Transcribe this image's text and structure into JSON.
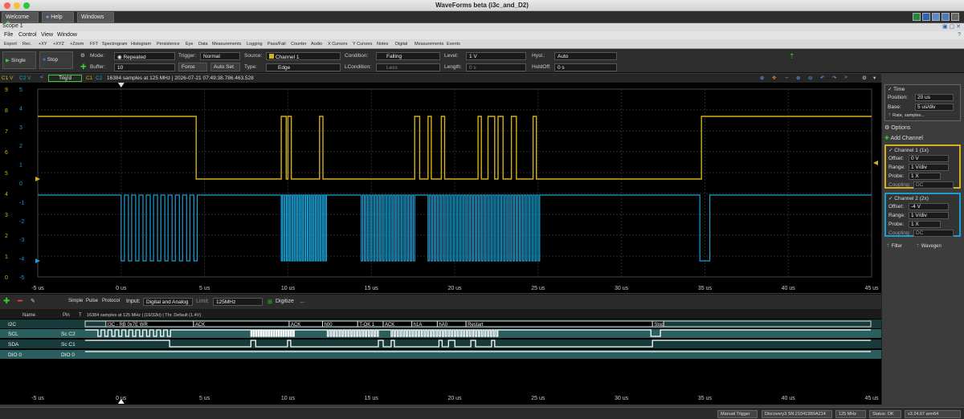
{
  "window": {
    "title": "WaveForms beta (i3c_and_D2)"
  },
  "tabs": [
    {
      "label": "Welcome"
    },
    {
      "label": "Help"
    },
    {
      "label": "Windows"
    }
  ],
  "scope": {
    "title": "Scope 1"
  },
  "menu": [
    "File",
    "Control",
    "View",
    "Window"
  ],
  "toolbar": [
    "Export",
    "Rec.",
    "+XY",
    "+XYZ",
    "+Zoom",
    "FFT",
    "Spectrogram",
    "Histogram",
    "Persistence",
    "Eye",
    "Data",
    "Measurements",
    "Logging",
    "Pass/Fail",
    "Counter",
    "Audio",
    "X Cursors",
    "Y Cursors",
    "Notes",
    "Digital",
    "Measurements",
    "Events"
  ],
  "controls": {
    "single": "Single",
    "stop": "Stop",
    "mode_label": "Mode:",
    "mode_value": "Repeated",
    "buffer_label": "Buffer:",
    "buffer_value": "10",
    "trigger_label": "Trigger:",
    "trigger_value": "Normal",
    "force": "Force",
    "autoset": "Auto Set",
    "source_label": "Source:",
    "source_value": "Channel 1",
    "type_label": "Type:",
    "type_value": "Edge",
    "condition_label": "Condition:",
    "condition_value": "Falling",
    "lcondition_label": "LCondition:",
    "lcondition_value": "Less",
    "level_label": "Level:",
    "level_value": "1 V",
    "length_label": "Length:",
    "length_value": "0 s",
    "hyst_label": "Hyst.:",
    "hyst_value": "Auto",
    "holdoff_label": "HoldOff:",
    "holdoff_value": "0 s"
  },
  "infobar": {
    "c1": "C1 V",
    "c2": "C2 V",
    "trig": "Trig'd",
    "c1b": "C1",
    "c2b": "C2",
    "text": "16384 samples at 125 MHz | 2026-07-21 07:49:38.786.463.528"
  },
  "plot": {
    "y_left1": [
      "9",
      "8",
      "7",
      "6",
      "5",
      "4",
      "3",
      "2",
      "1",
      "0"
    ],
    "y_left2": [
      "5",
      "4",
      "3",
      "2",
      "1",
      "0",
      "-1",
      "-2",
      "-3",
      "-4",
      "-5"
    ],
    "x_ticks": [
      "-5 us",
      "0 us",
      "5 us",
      "10 us",
      "15 us",
      "20 us",
      "25 us",
      "30 us",
      "35 us",
      "40 us",
      "45 us"
    ],
    "colors": {
      "ch1": "#d4b01c",
      "ch2": "#1a9fd4"
    }
  },
  "digital": {
    "simple": "Simple",
    "pulse": "Pulse",
    "protocol": "Protocol",
    "input_label": "Input:",
    "input_value": "Digital and Analog",
    "limit_label": "Limit:",
    "limit_value": "125MHz",
    "digitize": "Digitize",
    "col_name": "Name",
    "col_pin": "Pin",
    "col_t": "T",
    "info": "16384 samples at 125 MHz | (16/32ki) | Thr. Default (1.4V)",
    "rows": [
      {
        "name": "I2C",
        "pin": ""
      },
      {
        "name": "SCL",
        "pin": "Sc C2"
      },
      {
        "name": "SDA",
        "pin": "Sc C1"
      },
      {
        "name": "DIO 0",
        "pin": "DIO 0"
      }
    ],
    "decode": [
      "I3C - RB 0x7E WR",
      "ACK",
      "ACK",
      "h00",
      "T-OK 1",
      "ACK",
      "h1A",
      "hA0",
      "Restart",
      "Stop"
    ],
    "x_ticks": [
      "-5 us",
      "0 us",
      "5 us",
      "10 us",
      "15 us",
      "20 us",
      "25 us",
      "30 us",
      "35 us",
      "40 us",
      "45 us"
    ]
  },
  "panel": {
    "time_title": "Time",
    "position_label": "Position:",
    "position_value": "20 us",
    "base_label": "Base:",
    "base_value": "5 us/div",
    "rate": "Rate, samples...",
    "options": "Options",
    "add_channel": "Add Channel",
    "ch1_title": "Channel 1 (1x)",
    "ch1_offset_label": "Offset:",
    "ch1_offset": "0 V",
    "ch1_range_label": "Range:",
    "ch1_range": "1 V/div",
    "ch1_probe_label": "Probe:",
    "ch1_probe": "1 X",
    "ch1_coupling_label": "Coupling:",
    "ch1_coupling": "DC",
    "ch2_title": "Channel 2 (2x)",
    "ch2_offset_label": "Offset:",
    "ch2_offset": "-4 V",
    "ch2_range_label": "Range:",
    "ch2_range": "1 V/div",
    "ch2_probe_label": "Probe:",
    "ch2_probe": "1 X",
    "ch2_coupling_label": "Coupling:",
    "ch2_coupling": "DC",
    "filter": "Filter",
    "wavegen": "Wavegen"
  },
  "status": {
    "manual_trigger": "Manual Trigger",
    "device": "Discovery3 SN:210415B9A214",
    "rate": "125 MHz",
    "status": "Status: OK",
    "version": "v3.24.67 arm64"
  }
}
